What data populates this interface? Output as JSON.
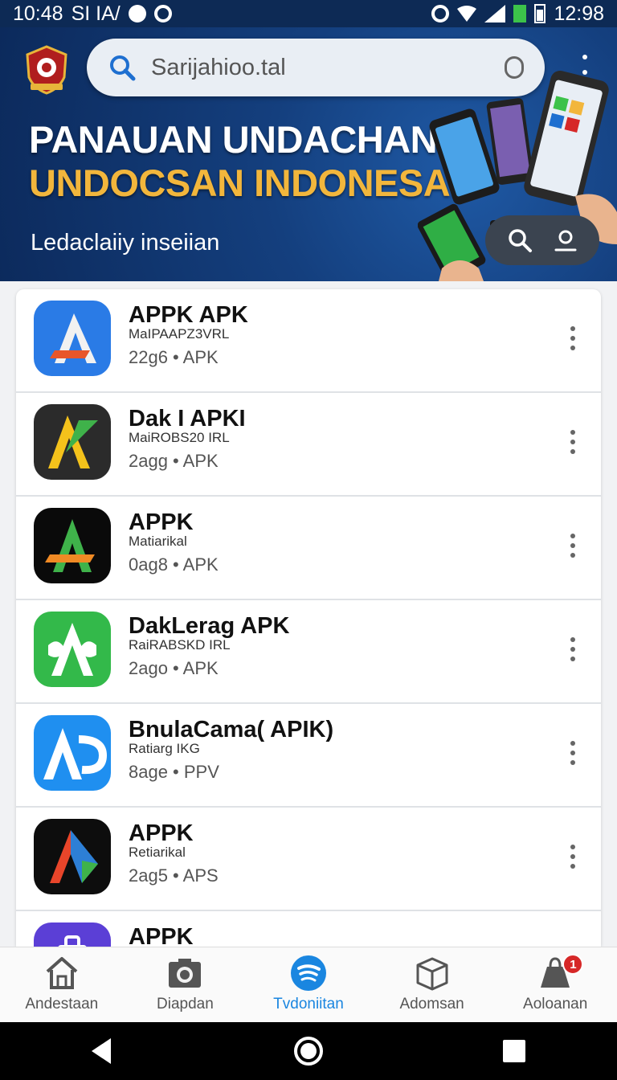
{
  "status_bar": {
    "time_left": "10:48",
    "carrier": "SI IA/",
    "time_right": "12:98"
  },
  "search": {
    "placeholder": "Sarijahioo.tal"
  },
  "banner": {
    "line1": "PANAUAN UNDACHAN",
    "line2": "UNDOCSAN INDONESAI",
    "subtitle": "Ledaclaiiy inseiian"
  },
  "apps": [
    {
      "name": "APPK APK",
      "developer": "MaIPAAPZ3VRL",
      "meta": "22g6 • APK",
      "icon": "app-icon-a-blue"
    },
    {
      "name": "Dak I APKI",
      "developer": "MaiROBS20 IRL",
      "meta": "2agg • APK",
      "icon": "app-icon-a-dark-yellow"
    },
    {
      "name": "APPK",
      "developer": "Matiarikal",
      "meta": "0ag8 • APK",
      "icon": "app-icon-a-black-green"
    },
    {
      "name": "DakLerag APK",
      "developer": "RaiRABSKD IRL",
      "meta": "2ago • APK",
      "icon": "app-icon-a-green"
    },
    {
      "name": "BnulaCama( APIK)",
      "developer": "Ratiarg IKG",
      "meta": "8age • PPV",
      "icon": "app-icon-ap-blue"
    },
    {
      "name": "APPK",
      "developer": "Retiarikal",
      "meta": "2ag5 • APS",
      "icon": "app-icon-a-multicolor"
    },
    {
      "name": "APPK",
      "developer": "",
      "meta": "",
      "icon": "app-icon-bag-purple"
    }
  ],
  "bottom_nav": [
    {
      "label": "Andestaan",
      "icon": "home-icon",
      "active": false
    },
    {
      "label": "Diapdan",
      "icon": "camera-icon",
      "active": false
    },
    {
      "label": "Tvdoniitan",
      "icon": "spotify-icon",
      "active": true
    },
    {
      "label": "Adomsan",
      "icon": "box-icon",
      "active": false
    },
    {
      "label": "Aoloanan",
      "icon": "bag-icon",
      "active": false,
      "badge": "1"
    }
  ],
  "colors": {
    "header_bg": "#143f7e",
    "accent_yellow": "#f2b63c",
    "active_nav": "#1a86e0",
    "badge": "#d62828"
  }
}
